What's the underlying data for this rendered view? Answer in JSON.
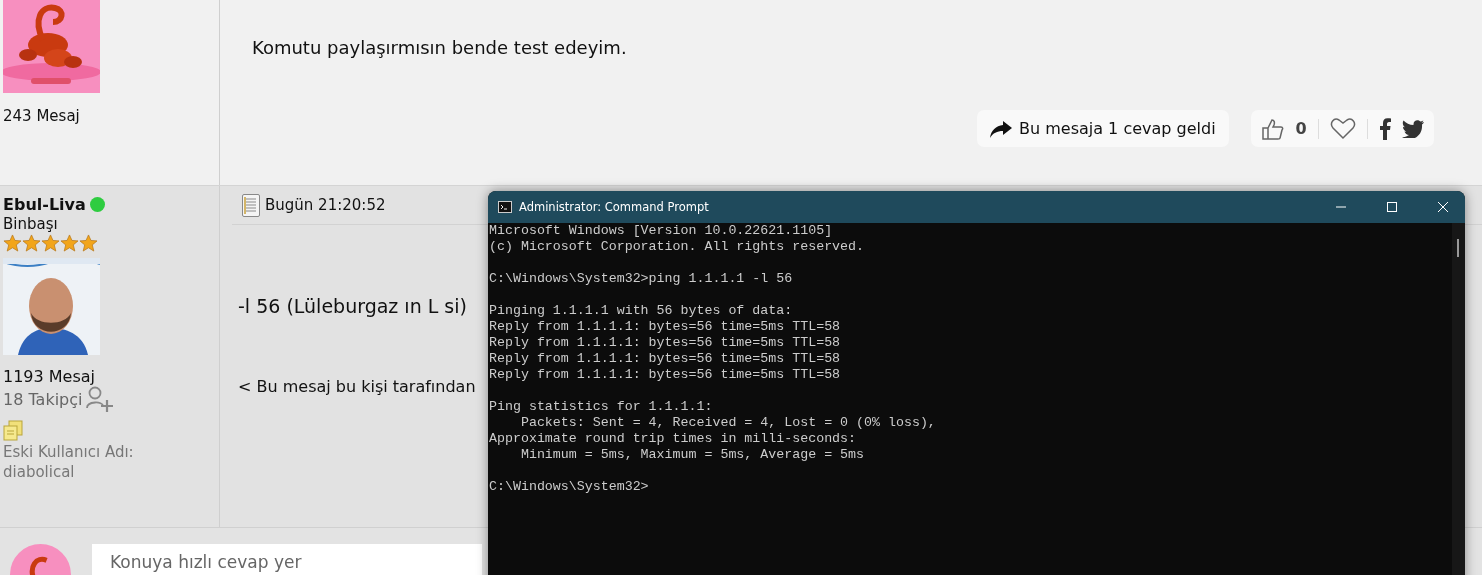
{
  "previous_post": {
    "message_count": "243 Mesaj",
    "message": "Komutu paylaşırmısın bende test edeyim.",
    "reply_notice": "Bu mesaja 1 cevap geldi",
    "likes": "0"
  },
  "post": {
    "username": "Ebul-Liva",
    "online": true,
    "rank": "Binbaşı",
    "stars": 5,
    "message_count": "1193 Mesaj",
    "followers": "18 Takipçi",
    "old_username_label": "Eski Kullanıcı Adı:",
    "old_username": "diabolical",
    "timestamp": "Bugün 21:20:52",
    "message": "-l 56 (Lüleburgaz ın L si)",
    "edit_note": "< Bu mesaj bu kişi tarafından"
  },
  "quick_reply": {
    "placeholder": "Konuya hızlı cevap yer"
  },
  "console_window": {
    "title": "Administrator: Command Prompt",
    "blocks": [
      [
        "Microsoft Windows [Version 10.0.22621.1105]",
        "(c) Microsoft Corporation. All rights reserved."
      ],
      [
        "C:\\Windows\\System32>ping 1.1.1.1 -l 56"
      ],
      [
        "Pinging 1.1.1.1 with 56 bytes of data:",
        "Reply from 1.1.1.1: bytes=56 time=5ms TTL=58",
        "Reply from 1.1.1.1: bytes=56 time=5ms TTL=58",
        "Reply from 1.1.1.1: bytes=56 time=5ms TTL=58",
        "Reply from 1.1.1.1: bytes=56 time=5ms TTL=58"
      ],
      [
        "Ping statistics for 1.1.1.1:",
        "    Packets: Sent = 4, Received = 4, Lost = 0 (0% loss),",
        "Approximate round trip times in milli-seconds:",
        "    Minimum = 5ms, Maximum = 5ms, Average = 5ms"
      ],
      [
        "C:\\Windows\\System32>"
      ]
    ]
  }
}
